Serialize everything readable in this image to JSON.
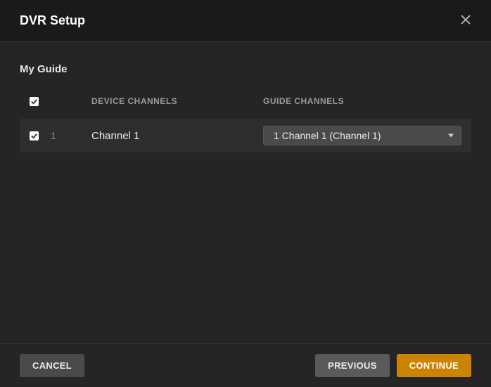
{
  "dialog": {
    "title": "DVR Setup",
    "section_title": "My Guide"
  },
  "table": {
    "headers": {
      "device": "DEVICE CHANNELS",
      "guide": "GUIDE CHANNELS"
    },
    "rows": [
      {
        "checked": true,
        "number": "1",
        "device_name": "Channel 1",
        "guide_selected": "1 Channel 1 (Channel 1)"
      }
    ]
  },
  "footer": {
    "cancel": "CANCEL",
    "previous": "PREVIOUS",
    "continue": "CONTINUE"
  }
}
